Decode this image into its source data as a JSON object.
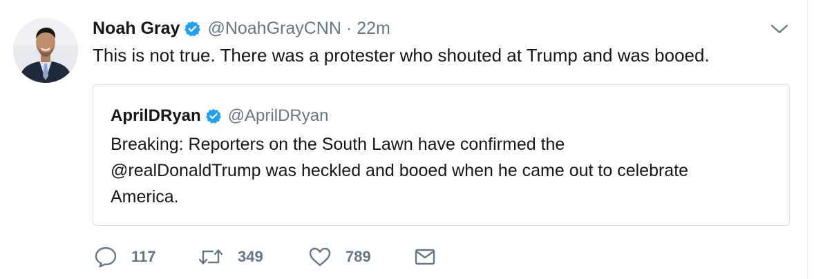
{
  "tweet": {
    "author": {
      "name": "Noah Gray",
      "handle": "@NoahGrayCNN",
      "verified": true
    },
    "separator": "·",
    "time": "22m",
    "text": "This is not true. There was a protester who shouted at Trump and was booed.",
    "quoted_tweet": {
      "author": {
        "name": "AprilDRyan",
        "handle": "@AprilDRyan",
        "verified": true
      },
      "text_lines": [
        "Breaking: Reporters on the South Lawn have confirmed the",
        "@realDonaldTrump was heckled and booed when he came out to celebrate",
        "America."
      ]
    },
    "actions": {
      "reply_count": "117",
      "retweet_count": "349",
      "like_count": "789"
    }
  },
  "icons": {
    "verified": "verified-badge-icon",
    "caret": "chevron-down-icon",
    "reply": "reply-icon",
    "retweet": "retweet-icon",
    "like": "heart-icon",
    "message": "envelope-icon"
  },
  "colors": {
    "text": "#14171a",
    "secondary": "#657786",
    "verified": "#1da1f2",
    "border": "#d7dde2"
  }
}
